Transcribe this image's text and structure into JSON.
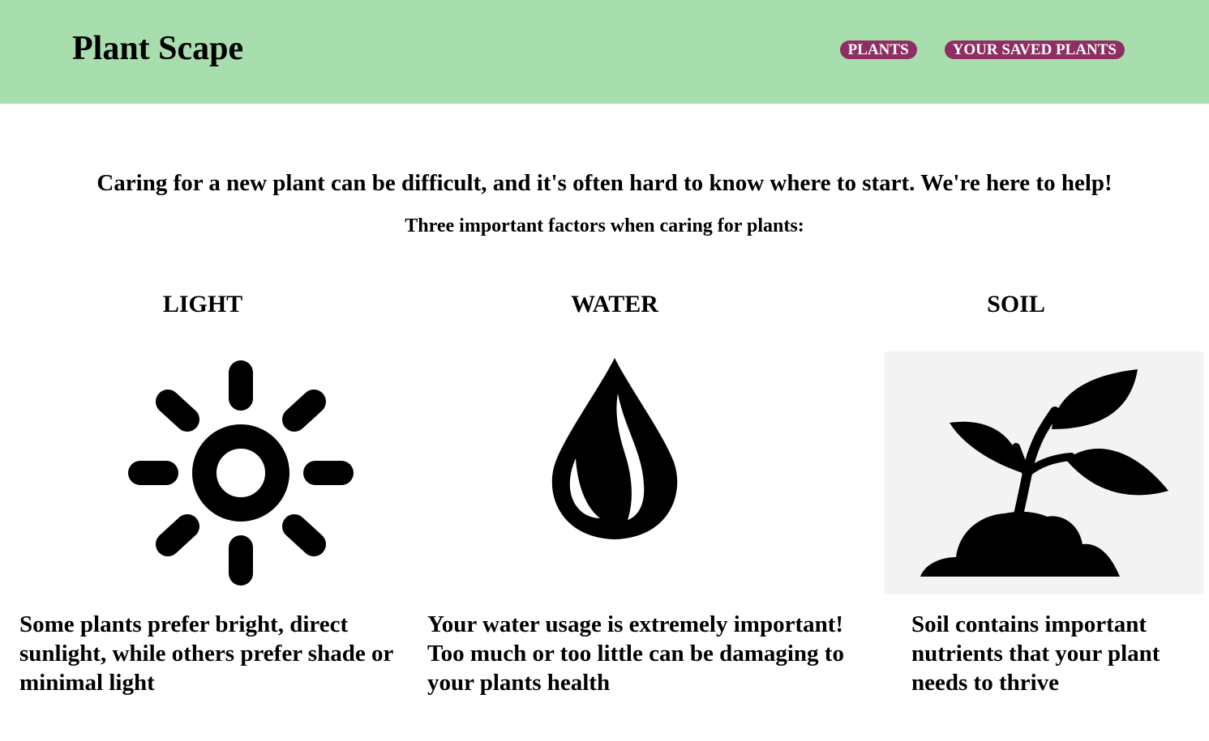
{
  "header": {
    "brand": "Plant Scape",
    "background_color": "#a8dead",
    "nav": [
      {
        "label": "PLANTS"
      },
      {
        "label": "YOUR SAVED PLANTS"
      }
    ],
    "nav_pill_color": "#8e2e62"
  },
  "intro": {
    "headline": "Caring for a new plant can be difficult, and it's often hard to know where to start. We're here to help!",
    "subheadline": "Three important factors when caring for plants:"
  },
  "factors": [
    {
      "title": "LIGHT",
      "icon": "sun-icon",
      "text": "Some plants prefer bright, direct sunlight, while others prefer shade or minimal light"
    },
    {
      "title": "WATER",
      "icon": "water-drop-icon",
      "text": "Your water usage is extremely important! Too much or too little can be damaging to your plants health"
    },
    {
      "title": "SOIL",
      "icon": "sprout-icon",
      "text": "Soil contains important nutrients that your plant needs to thrive"
    }
  ]
}
